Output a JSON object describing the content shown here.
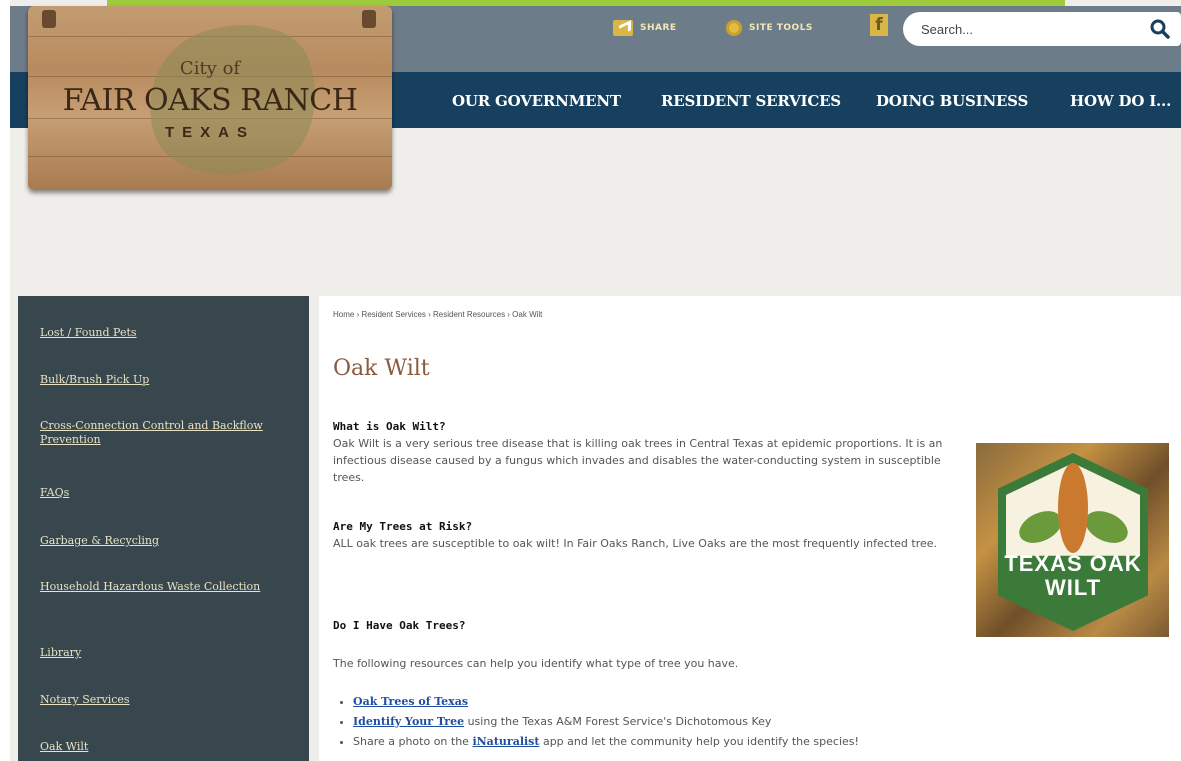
{
  "utility": {
    "share_label": "SHARE",
    "site_tools_label": "SITE TOOLS",
    "facebook_glyph": "f",
    "search_placeholder": "Search..."
  },
  "logo": {
    "line1": "City of",
    "line2": "FAIR OAKS RANCH",
    "line3": "TEXAS"
  },
  "nav": {
    "items": [
      "OUR GOVERNMENT",
      "RESIDENT SERVICES",
      "DOING BUSINESS",
      "HOW DO I..."
    ]
  },
  "sidebar": {
    "items": [
      "Lost / Found Pets",
      "Bulk/Brush Pick Up",
      "Cross-Connection Control and Backflow Prevention",
      "FAQs",
      "Garbage & Recycling",
      "Household Hazardous Waste Collection",
      "Library",
      "Notary Services",
      "Oak Wilt"
    ]
  },
  "breadcrumb": "Home › Resident Services › Resident Resources › Oak Wilt",
  "page": {
    "title": "Oak Wilt",
    "q1": "What is Oak Wilt?",
    "a1": "Oak Wilt is a very serious tree disease that is killing oak trees in Central Texas at epidemic proportions. It is an infectious disease caused by a fungus which invades and disables the water-conducting system in susceptible trees.",
    "q2": "Are My Trees at Risk?",
    "a2": "ALL oak trees are susceptible to oak wilt! In Fair Oaks Ranch, Live Oaks are the most frequently infected tree.",
    "q3": "Do I Have Oak Trees?",
    "a3": "The following resources can help you identify what type of tree you have.",
    "links": {
      "b1_link": "Oak Trees of Texas",
      "b2_link": "Identify Your Tree",
      "b2_rest": " using the Texas A&M Forest Service's Dichotomous Key",
      "b3_pre": "Share a photo on the ",
      "b3_link": "iNaturalist",
      "b3_rest": " app and let the community help you identify the species!"
    },
    "badge_line1": "TEXAS OAK",
    "badge_line2": "WILT"
  },
  "colors": {
    "nav_bg": "#17405e",
    "utility_bg": "#6d7c89",
    "accent_green": "#9dcb3b",
    "sidebar_bg": "#38474d",
    "title_brown": "#8a5a3c",
    "link_blue": "#1f4ea1"
  }
}
